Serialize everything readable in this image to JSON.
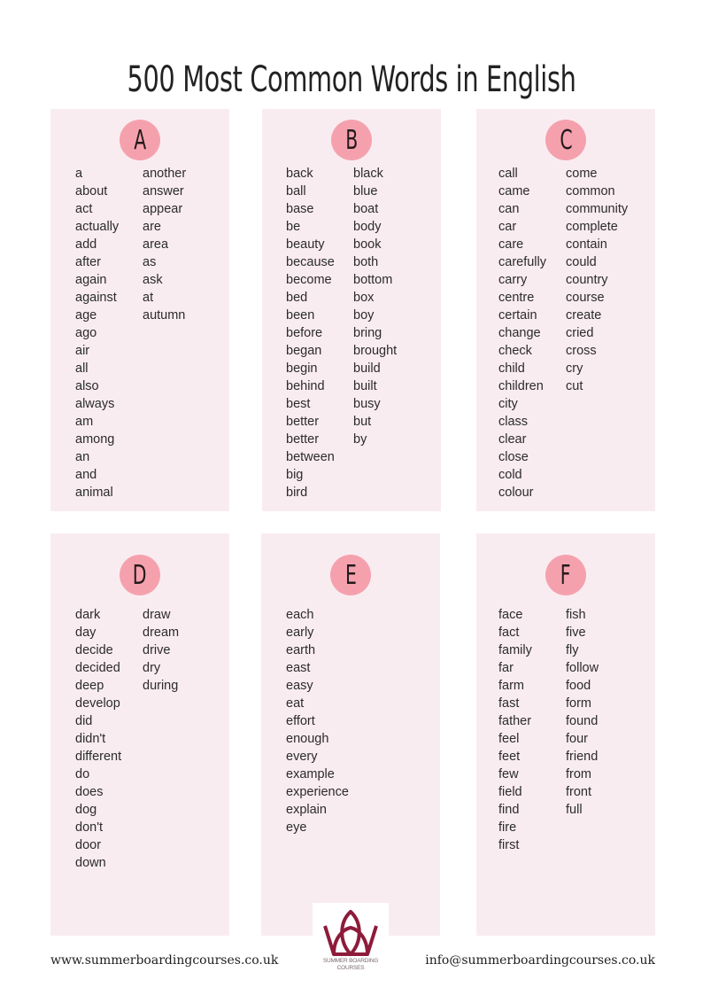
{
  "title": "500 Most Common Words in English",
  "accent_color": "#f5a1ad",
  "panel_color": "#f9ecf1",
  "sections": [
    {
      "letter": "A",
      "columns": [
        [
          "a",
          "about",
          "act",
          "actually",
          "add",
          "after",
          "again",
          "against",
          "age",
          "ago",
          "air",
          "all",
          "also",
          "always",
          "am",
          "among",
          "an",
          "and",
          "animal"
        ],
        [
          "another",
          "answer",
          "appear",
          "are",
          "area",
          "as",
          "ask",
          "at",
          "autumn"
        ]
      ]
    },
    {
      "letter": "B",
      "columns": [
        [
          "back",
          "ball",
          "base",
          "be",
          "beauty",
          "because",
          "become",
          "bed",
          "been",
          "before",
          "began",
          "begin",
          "behind",
          "best",
          "better",
          "better",
          "between",
          "big",
          "bird"
        ],
        [
          "black",
          "blue",
          "boat",
          "body",
          "book",
          "both",
          "bottom",
          "box",
          "boy",
          "bring",
          "brought",
          "build",
          "built",
          "busy",
          "but",
          "by"
        ]
      ]
    },
    {
      "letter": "C",
      "columns": [
        [
          "call",
          "came",
          "can",
          "car",
          "care",
          "carefully",
          "carry",
          "centre",
          "certain",
          "change",
          "check",
          "child",
          "children",
          "city",
          "class",
          "clear",
          "close",
          "cold",
          "colour"
        ],
        [
          "come",
          "common",
          "community",
          "complete",
          "contain",
          "could",
          "country",
          "course",
          "create",
          "cried",
          "cross",
          "cry",
          "cut"
        ]
      ]
    },
    {
      "letter": "D",
      "columns": [
        [
          "dark",
          "day",
          "decide",
          "decided",
          "deep",
          "develop",
          "did",
          "didn't",
          "different",
          "do",
          "does",
          "dog",
          "don't",
          "door",
          "down"
        ],
        [
          "draw",
          "dream",
          "drive",
          "dry",
          "during"
        ]
      ]
    },
    {
      "letter": "E",
      "columns": [
        [
          "each",
          "early",
          "earth",
          "east",
          "easy",
          "eat",
          "effort",
          "enough",
          "every",
          "example",
          "experience",
          "explain",
          "eye"
        ],
        []
      ]
    },
    {
      "letter": "F",
      "columns": [
        [
          "face",
          "fact",
          "family",
          "far",
          "farm",
          "fast",
          "father",
          "feel",
          "feet",
          "few",
          "field",
          "find",
          "fire",
          "first"
        ],
        [
          "fish",
          "five",
          "fly",
          "follow",
          "food",
          "form",
          "found",
          "four",
          "friend",
          "from",
          "front",
          "full"
        ]
      ]
    }
  ],
  "footer": {
    "website": "www.summerboardingcourses.co.uk",
    "email": "info@summerboardingcourses.co.uk",
    "logo_line1": "SUMMER BOARDING",
    "logo_line2": "COURSES"
  }
}
